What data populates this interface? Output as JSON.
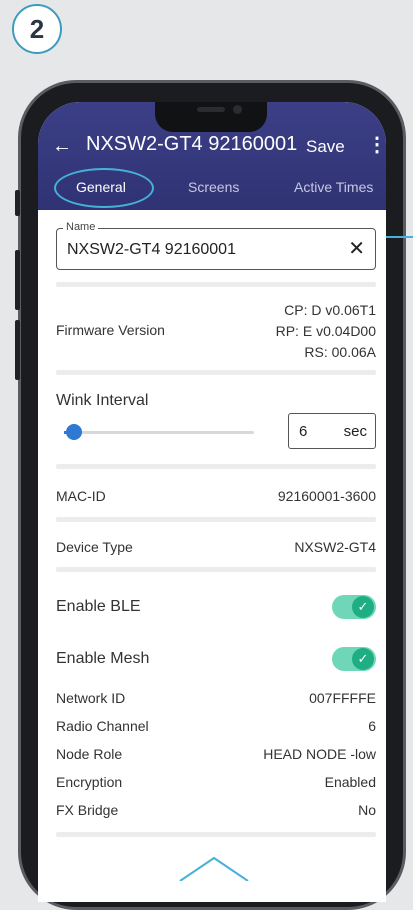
{
  "step": {
    "number": "2"
  },
  "appbar": {
    "back_icon": "←",
    "title": "NXSW2-GT4 92160001",
    "save": "Save",
    "more_icon": "⋮",
    "tabs": [
      {
        "label": "General",
        "active": true
      },
      {
        "label": "Screens",
        "active": false
      },
      {
        "label": "Active Times",
        "active": false
      }
    ]
  },
  "name_field": {
    "legend": "Name",
    "value": "NXSW2-GT4 92160001",
    "clear_icon": "✕"
  },
  "firmware": {
    "label": "Firmware Version",
    "lines": [
      "CP: D v0.06T1",
      "RP: E v0.04D00",
      "RS: 00.06A"
    ]
  },
  "wink": {
    "label": "Wink Interval",
    "value": "6",
    "unit": "sec",
    "slider_level": 0.05
  },
  "rows": {
    "mac_label": "MAC-ID",
    "mac_value": "92160001-3600",
    "device_type_label": "Device Type",
    "device_type_value": "NXSW2-GT4",
    "enable_ble_label": "Enable BLE",
    "enable_mesh_label": "Enable Mesh",
    "network_id_label": "Network ID",
    "network_id_value": "007FFFFE",
    "radio_channel_label": "Radio Channel",
    "radio_channel_value": "6",
    "node_role_label": "Node Role",
    "node_role_value": "HEAD NODE -low",
    "encryption_label": "Encryption",
    "encryption_value": "Enabled",
    "fx_bridge_label": "FX Bridge",
    "fx_bridge_value": "No"
  },
  "toggles": {
    "ble_on": true,
    "mesh_on": true,
    "check_icon": "✓"
  },
  "colors": {
    "appbar": "#33377a",
    "highlight": "#47b1d8",
    "toggle_on": "#1fae84",
    "slider": "#2d79d3"
  }
}
